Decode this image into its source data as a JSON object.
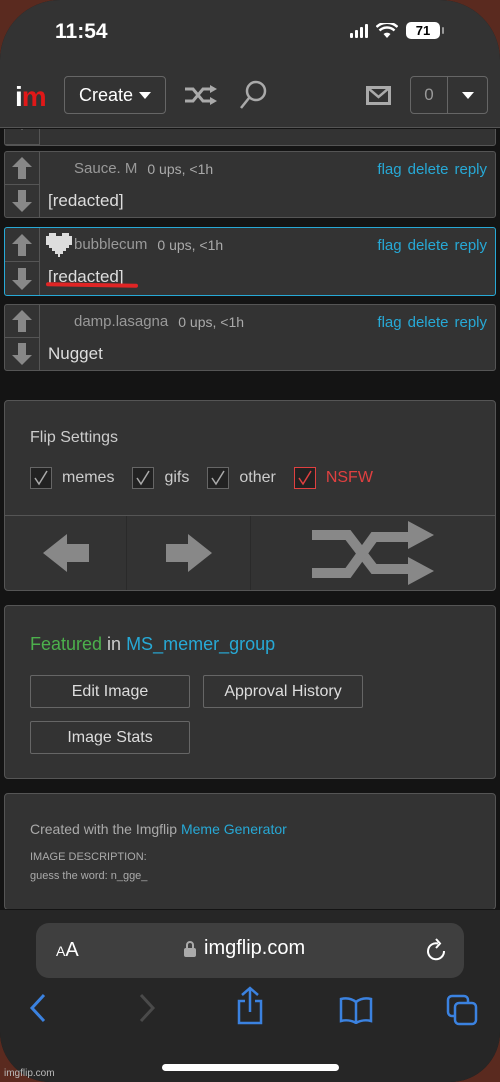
{
  "status_bar": {
    "time": "11:54",
    "battery": "71"
  },
  "topnav": {
    "logo_i": "i",
    "logo_m": "m",
    "create_label": "Create",
    "notification_count": "0"
  },
  "comments": [
    {
      "user": "Sauce.  M",
      "meta": "0 ups, <1h",
      "text": "[redacted]",
      "actions": [
        "flag",
        "delete",
        "reply"
      ]
    },
    {
      "user": "bubblecum",
      "meta": "0 ups, <1h",
      "text": "[redacted]",
      "actions": [
        "flag",
        "delete",
        "reply"
      ]
    },
    {
      "user": "damp.lasagna",
      "meta": "0 ups, <1h",
      "text": "Nugget",
      "actions": [
        "flag",
        "delete",
        "reply"
      ]
    }
  ],
  "flip_settings": {
    "title": "Flip Settings",
    "options": [
      {
        "label": "memes",
        "checked": true
      },
      {
        "label": "gifs",
        "checked": true
      },
      {
        "label": "other",
        "checked": true
      },
      {
        "label": "NSFW",
        "checked": true
      }
    ]
  },
  "featured": {
    "featured_word": "Featured",
    "in_word": " in ",
    "group": "MS_memer_group",
    "buttons": {
      "edit": "Edit Image",
      "approval": "Approval History",
      "stats": "Image Stats"
    }
  },
  "info": {
    "created_prefix": "Created with the Imgflip ",
    "created_link": "Meme Generator",
    "description_label": "IMAGE DESCRIPTION:",
    "description_text": "guess the word: n_gge_"
  },
  "safari": {
    "aa_small": "A",
    "aa_large": "A",
    "url": "imgflip.com"
  },
  "watermark": "imgflip.com",
  "colors": {
    "link": "#27a9d6",
    "featured": "#4cb04c",
    "nsfw": "#e04040",
    "logo_red": "#e01818",
    "ios_blue": "#3b82e0"
  }
}
